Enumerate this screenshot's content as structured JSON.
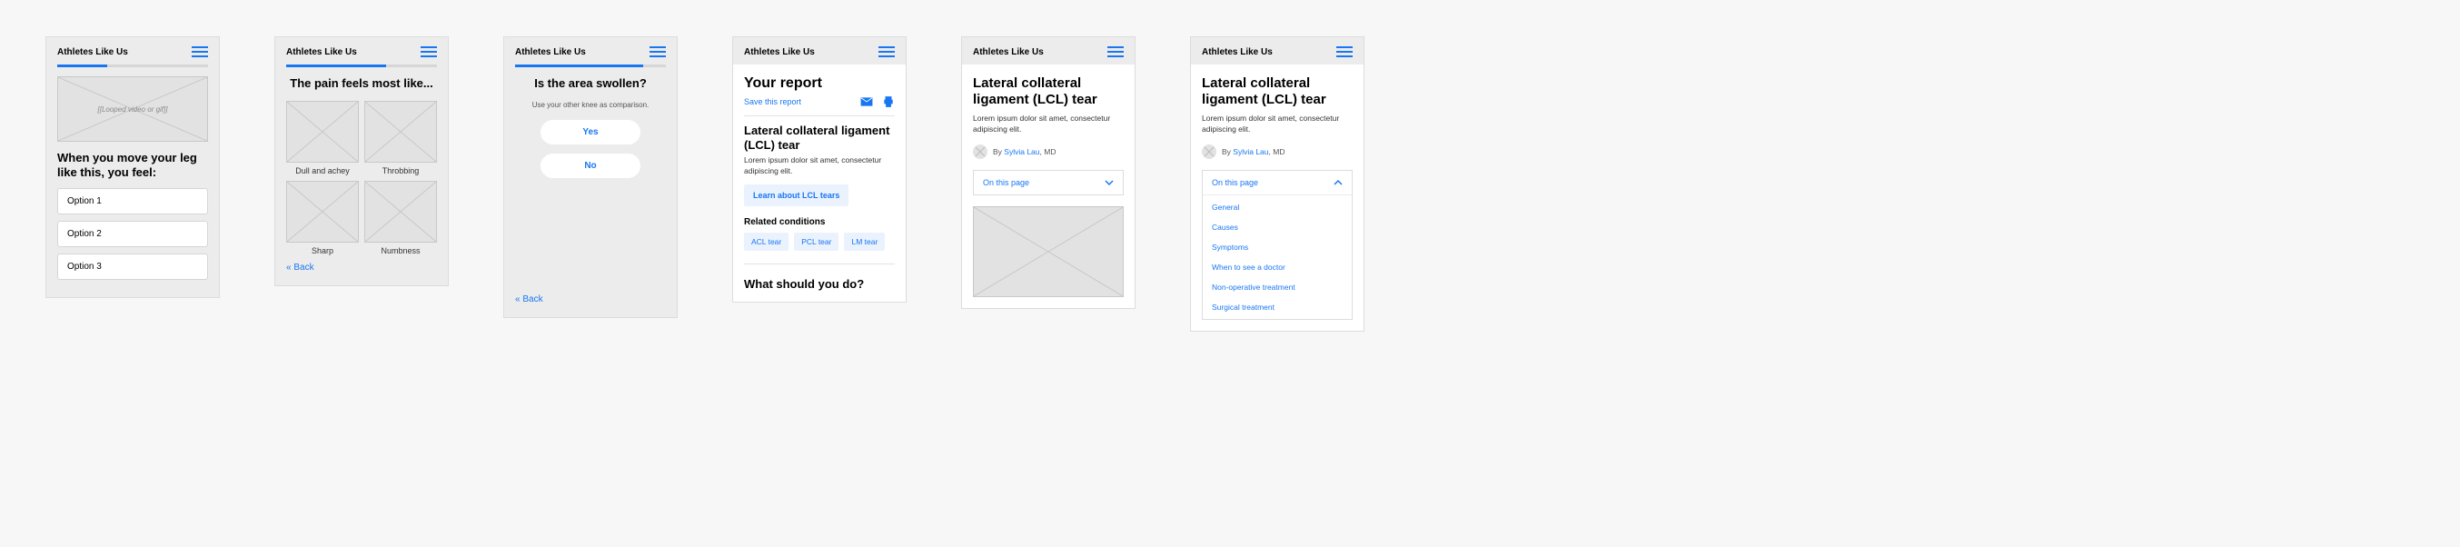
{
  "brand": "Athletes Like Us",
  "screen1": {
    "media_label": "[[Looped video or gif]]",
    "question": "When you move your leg like this, you feel:",
    "options": [
      "Option 1",
      "Option 2",
      "Option 3"
    ]
  },
  "screen2": {
    "question": "The pain feels most like...",
    "cells": [
      "Dull and achey",
      "Throbbing",
      "Sharp",
      "Numbness"
    ],
    "back": "« Back"
  },
  "screen3": {
    "question": "Is the area swollen?",
    "sub": "Use your other knee as comparison.",
    "yes": "Yes",
    "no": "No",
    "back": "« Back"
  },
  "screen4": {
    "title": "Your report",
    "save": "Save this report",
    "condition": "Lateral collateral ligament (LCL) tear",
    "desc": "Lorem ipsum dolor sit amet, consectetur adipiscing elit.",
    "learn": "Learn about LCL tears",
    "related_h": "Related conditions",
    "chips": [
      "ACL tear",
      "PCL tear",
      "LM tear"
    ],
    "next_h": "What should you do?"
  },
  "article": {
    "title": "Lateral collateral ligament (LCL) tear",
    "desc": "Lorem ipsum dolor sit amet, consectetur adipiscing elit.",
    "by": "By",
    "author": "Sylvia Lau",
    "cred": ", MD",
    "toc_label": "On this page",
    "toc_items": [
      "General",
      "Causes",
      "Symptoms",
      "When to see a doctor",
      "Non-operative treatment",
      "Surgical treatment"
    ]
  }
}
